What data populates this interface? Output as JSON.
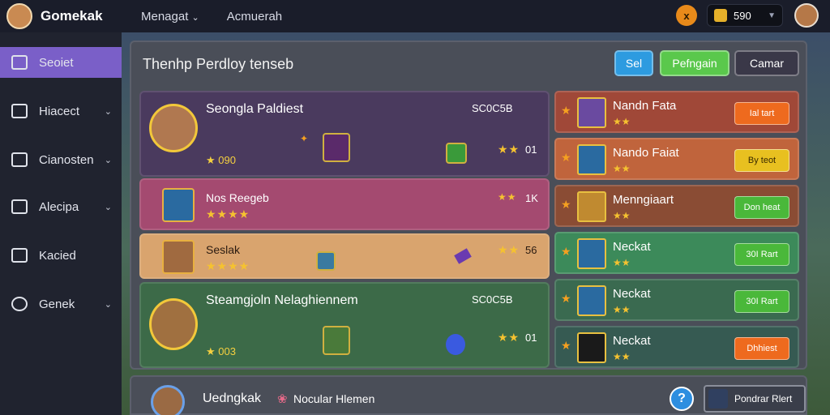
{
  "topbar": {
    "brand": "Gomekak",
    "nav": [
      "Menagat",
      "Acmuerah"
    ],
    "coin_label": "x",
    "gold_value": "590",
    "dropdown_arrow": "⌄"
  },
  "sidebar": {
    "items": [
      {
        "label": "Seoiet",
        "icon": "home-icon"
      },
      {
        "label": "Hiacect",
        "icon": "monitor-icon"
      },
      {
        "label": "Cianosten",
        "icon": "users-icon"
      },
      {
        "label": "Alecipa",
        "icon": "chart-icon"
      },
      {
        "label": "Kacied",
        "icon": "box-icon"
      },
      {
        "label": "Genek",
        "icon": "info-icon"
      }
    ]
  },
  "panel": {
    "title": "Thenhp Perdloy tenseb",
    "buttons": {
      "sort": "Sel",
      "progress": "Pefngain",
      "camar": "Camar"
    }
  },
  "cards": [
    {
      "name": "Seongla Paldiest",
      "score": "SC0C5B",
      "points": "★ 090",
      "level": "01",
      "stars": "★★"
    },
    {
      "name": "Nos Reegeb",
      "stars": "★★★★",
      "level": "1K",
      "rank_stars": "★★"
    },
    {
      "name": "Seslak",
      "stars": "★★★★",
      "level": "56",
      "rank_stars": "★★"
    },
    {
      "name": "Steamgjoln Nelaghiennem",
      "score": "SC0C5B",
      "points": "★ 003",
      "level": "01",
      "stars": "★★"
    }
  ],
  "right_list": [
    {
      "name": "Nandn Fata",
      "button": "Ial tart",
      "color": "#a04838",
      "btn_color": "#ee6a1e"
    },
    {
      "name": "Nando Faiat",
      "button": "By teot",
      "color": "#c0643c",
      "btn_color": "#e8c020"
    },
    {
      "name": "Menngiaart",
      "button": "Don heat",
      "color": "#8a4c34",
      "btn_color": "#4ab83a"
    },
    {
      "name": "Neckat",
      "button": "30I Rart",
      "color": "#3c8a5a",
      "btn_color": "#4ab83a"
    },
    {
      "name": "Neckat",
      "button": "30I Rart",
      "color": "#3a6a50",
      "btn_color": "#4ab83a"
    },
    {
      "name": "Neckat",
      "button": "Dhhiest",
      "color": "#365a52",
      "btn_color": "#ee6a1e"
    }
  ],
  "bottom": {
    "name": "Uedngkak",
    "rose": "❀",
    "player": "Nocular Hlemen",
    "help": "?",
    "button": "Pondrar Rlert"
  }
}
